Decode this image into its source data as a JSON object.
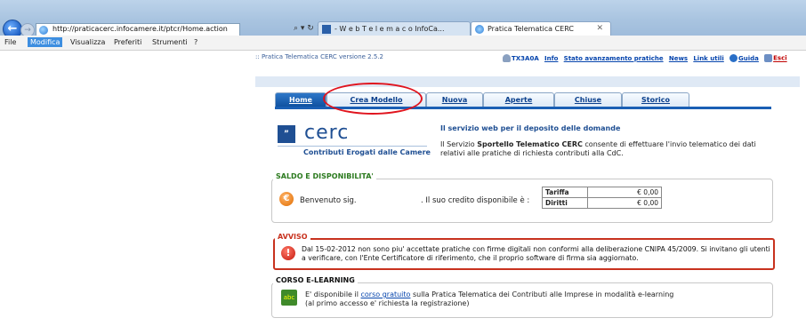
{
  "browser": {
    "url": "http://praticacerc.infocamere.it/ptcr/Home.action",
    "address_tools": "⌕ ▾ ↻ ✕",
    "tabs": [
      {
        "label": "- W e b T e l e m a c o InfoCa..."
      },
      {
        "label": "Pratica Telematica CERC"
      }
    ],
    "menu": [
      "File",
      "Modifica",
      "Visualizza",
      "Preferiti",
      "Strumenti",
      "?"
    ]
  },
  "header": {
    "version": ":: Pratica Telematica CERC versione 2.5.2",
    "user": "TX3A0A",
    "links": [
      "Info",
      "Stato avanzamento pratiche",
      "News",
      "Link utili",
      "Guida",
      "Esci"
    ]
  },
  "nav_tabs": [
    "Home",
    "Crea Modello",
    "Nuova",
    "Aperte",
    "Chiuse",
    "Storico"
  ],
  "intro": {
    "logo_badge": "”",
    "logo_text": "cerc",
    "logo_subtitle": "Contributi Erogati dalle Camere",
    "title": "Il servizio web per il deposito delle domande",
    "description_pre": "Il Servizio ",
    "description_bold": "Sportello Telematico CERC",
    "description_post": " consente di effettuare l'invio telematico dei dati relativi alle pratiche di richiesta contributi alla CdC."
  },
  "saldo": {
    "title": "SALDO E DISPONIBILITA'",
    "welcome": "Benvenuto sig.",
    "credit_label": ". Il suo credito disponibile è :",
    "rows": [
      {
        "label": "Tariffa",
        "value": "€ 0,00"
      },
      {
        "label": "Diritti",
        "value": "€ 0,00"
      }
    ]
  },
  "avviso": {
    "title": "AVVISO",
    "text": "Dal 15-02-2012 non sono piu' accettate pratiche con firme digitali non conformi alla deliberazione CNIPA 45/2009. Si invitano gli utenti a verificare, con l'Ente Certificatore di riferimento, che il proprio software di firma sia aggiornato."
  },
  "corso": {
    "title": "CORSO E-LEARNING",
    "text_pre": "E' disponibile il ",
    "link": "corso gratuito",
    "text_post": " sulla Pratica Telematica dei Contributi alle Imprese in modalità e-learning",
    "text_line2": "(al primo accesso e' richiesta la registrazione)"
  }
}
